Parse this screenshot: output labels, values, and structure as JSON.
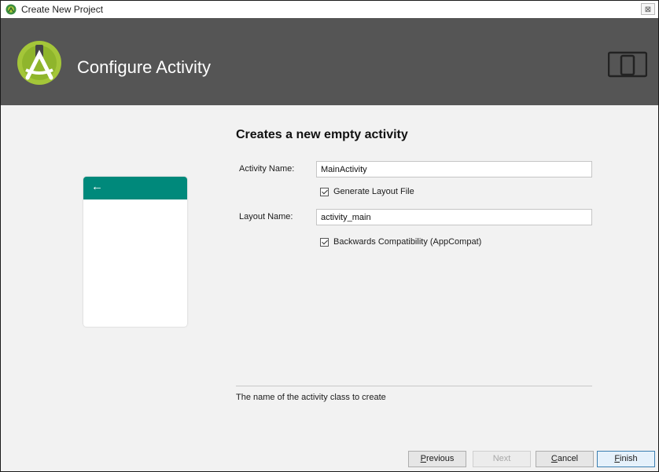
{
  "window": {
    "title": "Create New Project",
    "close_label": "⊠"
  },
  "header": {
    "heading": "Configure Activity"
  },
  "form": {
    "heading": "Creates a new empty activity",
    "activity_name_label": "Activity Name:",
    "activity_name_value": "MainActivity",
    "generate_layout_label": "Generate Layout File",
    "generate_layout_checked": true,
    "layout_name_label": "Layout Name:",
    "layout_name_value": "activity_main",
    "backwards_compat_label": "Backwards Compatibility (AppCompat)",
    "backwards_compat_checked": true,
    "help_text": "The name of the activity class to create"
  },
  "preview": {
    "back_glyph": "←"
  },
  "footer": {
    "previous_mnemonic": "P",
    "previous_rest": "revious",
    "next_label": "Next",
    "cancel_mnemonic": "C",
    "cancel_rest": "ancel",
    "finish_mnemonic": "F",
    "finish_rest": "inish"
  },
  "colors": {
    "header_bg": "#555555",
    "preview_bar": "#00897b",
    "android_green": "#a4c639"
  }
}
